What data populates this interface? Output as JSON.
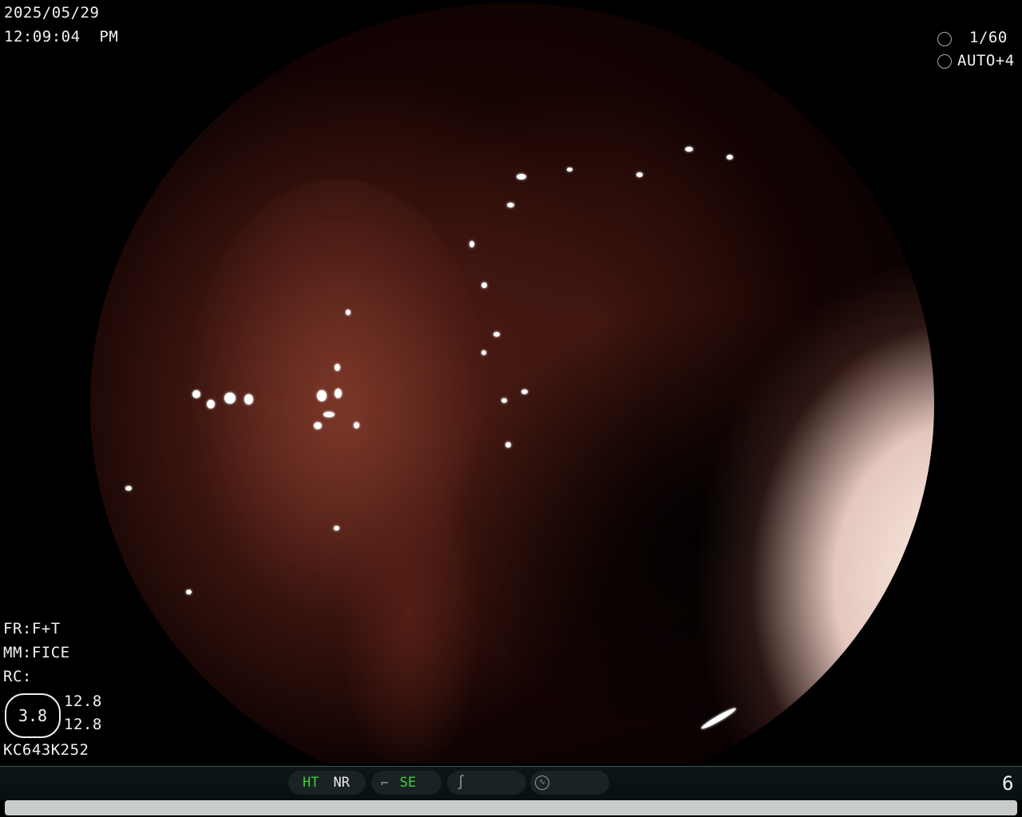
{
  "datetime": {
    "date": "2025/05/29",
    "time": "12:09:04  PM"
  },
  "exposure": {
    "shutter_icon": "shutter-icon",
    "shutter": "1/60",
    "iris_icon": "iris-icon",
    "iris": "AUTO+4"
  },
  "settings": {
    "fr": "FR:F+T",
    "mm": "MM:FICE",
    "rc": "RC:"
  },
  "rc_panel": {
    "badge": "3.8",
    "line1": "12.8",
    "line2": "12.8"
  },
  "scope_id": "KC643K252",
  "status_bar": {
    "ht": "HT",
    "nr": "NR",
    "se_icon": "enhancement-curve-icon",
    "se": "SE",
    "tone_icon": "tone-curve-icon",
    "mode_icon": "waveform-circle-icon",
    "page_number": "6"
  },
  "colors": {
    "ht": "#3ed03e",
    "se": "#3ed03e",
    "nr": "#eaeaea"
  }
}
